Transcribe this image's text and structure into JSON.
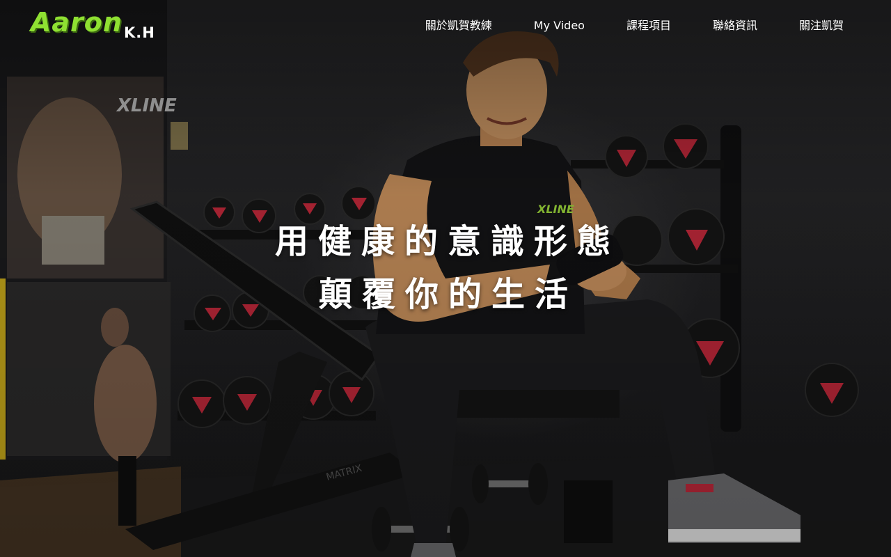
{
  "header": {
    "logo": {
      "main": "Aaron",
      "sub": "K.H"
    },
    "nav": [
      {
        "label": "關於凱賀教練"
      },
      {
        "label": "My Video"
      },
      {
        "label": "課程項目"
      },
      {
        "label": "聯絡資訊"
      },
      {
        "label": "關注凱賀"
      }
    ]
  },
  "hero": {
    "headline_line1": "用健康的意識形態",
    "headline_line2": "顛覆你的生活",
    "poster_brand": "XLINE",
    "shirt_brand": "XLINE",
    "bench_brand": "MATRIX"
  },
  "colors": {
    "brand_green": "#8fe032",
    "dumbbell_red": "#c0283a",
    "background": "#1e1e20"
  }
}
